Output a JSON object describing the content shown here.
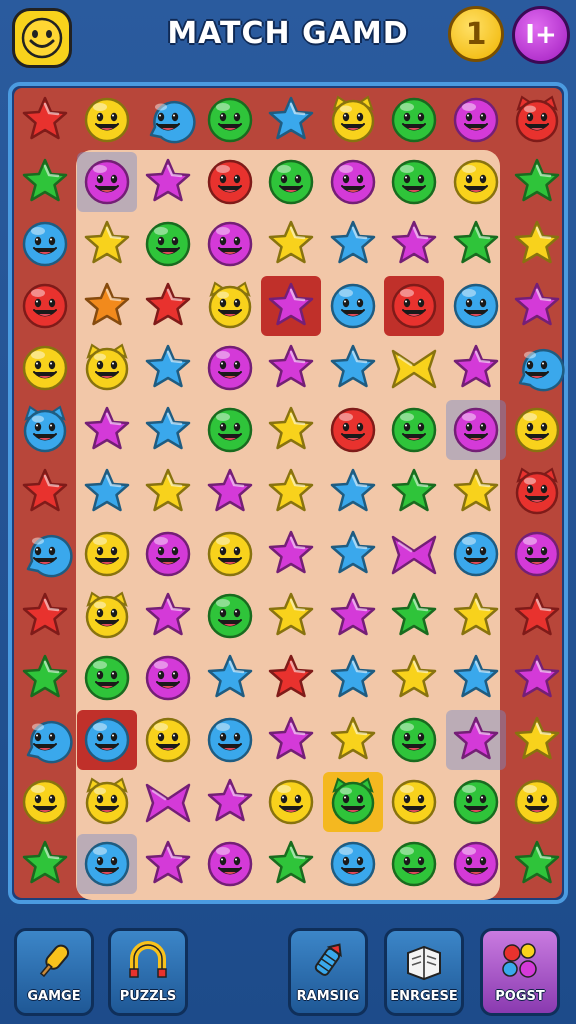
{
  "header": {
    "title": "MATCH GAMD",
    "coin_value": "1",
    "plus_label": "I+"
  },
  "board": {
    "cols": 9,
    "rows": 13,
    "cells": [
      [
        "star-red",
        "smile-yellow",
        "chat-blue",
        "smile-green",
        "star-blue",
        "cat-yellow",
        "smile-green",
        "smile-magenta",
        "cat-red"
      ],
      [
        "star-green",
        "smile-magenta",
        "star-magenta",
        "smile-red",
        "smile-green",
        "smile-magenta",
        "smile-green",
        "smile-yellow",
        "star-green"
      ],
      [
        "smile-blue",
        "star-yellow",
        "smile-green",
        "smile-magenta",
        "star-yellow",
        "star-blue",
        "star-magenta",
        "star-green",
        "star-yellow"
      ],
      [
        "smile-red",
        "star-orange",
        "star-red",
        "cat-yellow",
        "star-magenta",
        "smile-blue",
        "smile-red",
        "smile-blue",
        "star-magenta"
      ],
      [
        "smile-yellow",
        "cat-yellow",
        "star-blue",
        "smile-magenta",
        "star-magenta",
        "star-blue",
        "bow-yellow",
        "star-magenta",
        "chat-blue"
      ],
      [
        "cat-blue",
        "star-magenta",
        "star-blue",
        "smile-green",
        "star-yellow",
        "smile-red",
        "smile-green",
        "smile-magenta",
        "smile-yellow"
      ],
      [
        "star-red",
        "star-blue",
        "star-yellow",
        "star-magenta",
        "star-yellow",
        "star-blue",
        "star-green",
        "star-yellow",
        "cat-red"
      ],
      [
        "chat-blue",
        "smile-yellow",
        "smile-magenta",
        "smile-yellow",
        "star-magenta",
        "star-blue",
        "bow-magenta",
        "smile-blue",
        "smile-magenta"
      ],
      [
        "star-red",
        "cat-yellow",
        "star-magenta",
        "smile-green",
        "star-yellow",
        "star-magenta",
        "star-green",
        "star-yellow",
        "star-red"
      ],
      [
        "star-green",
        "smile-green",
        "smile-magenta",
        "star-blue",
        "star-red",
        "star-blue",
        "star-yellow",
        "star-blue",
        "star-magenta"
      ],
      [
        "chat-blue",
        "smile-blue",
        "smile-yellow",
        "smile-blue",
        "star-magenta",
        "star-yellow",
        "smile-green",
        "star-magenta",
        "star-yellow"
      ],
      [
        "smile-yellow",
        "cat-yellow",
        "bow-magenta",
        "star-magenta",
        "smile-yellow",
        "cat-green",
        "smile-yellow",
        "smile-green",
        "smile-yellow"
      ],
      [
        "star-green",
        "smile-blue",
        "star-magenta",
        "smile-magenta",
        "star-green",
        "smile-blue",
        "smile-green",
        "smile-magenta",
        "star-green"
      ]
    ],
    "highlights": [
      {
        "row": 1,
        "col": 1,
        "color": "blue"
      },
      {
        "row": 3,
        "col": 4,
        "color": "red"
      },
      {
        "row": 3,
        "col": 6,
        "color": "red"
      },
      {
        "row": 5,
        "col": 7,
        "color": "blue"
      },
      {
        "row": 10,
        "col": 1,
        "color": "red"
      },
      {
        "row": 10,
        "col": 7,
        "color": "blue"
      },
      {
        "row": 11,
        "col": 5,
        "color": "yellow"
      },
      {
        "row": 12,
        "col": 1,
        "color": "blue"
      }
    ]
  },
  "palette": {
    "red": "#e8322e",
    "yellow": "#f8d21c",
    "blue": "#3aa8ec",
    "green": "#2fc43a",
    "magenta": "#d43ad8",
    "orange": "#f28a1c"
  },
  "bottom_buttons": [
    {
      "label": "GAMGE",
      "icon": "popsicle-icon"
    },
    {
      "label": "PUZZLS",
      "icon": "magnet-icon"
    },
    {
      "label": "RAMSIIG",
      "icon": "rocket-icon"
    },
    {
      "label": "ENRGESE",
      "icon": "book-icon"
    },
    {
      "label": "POGST",
      "icon": "puzzle-icon"
    }
  ]
}
